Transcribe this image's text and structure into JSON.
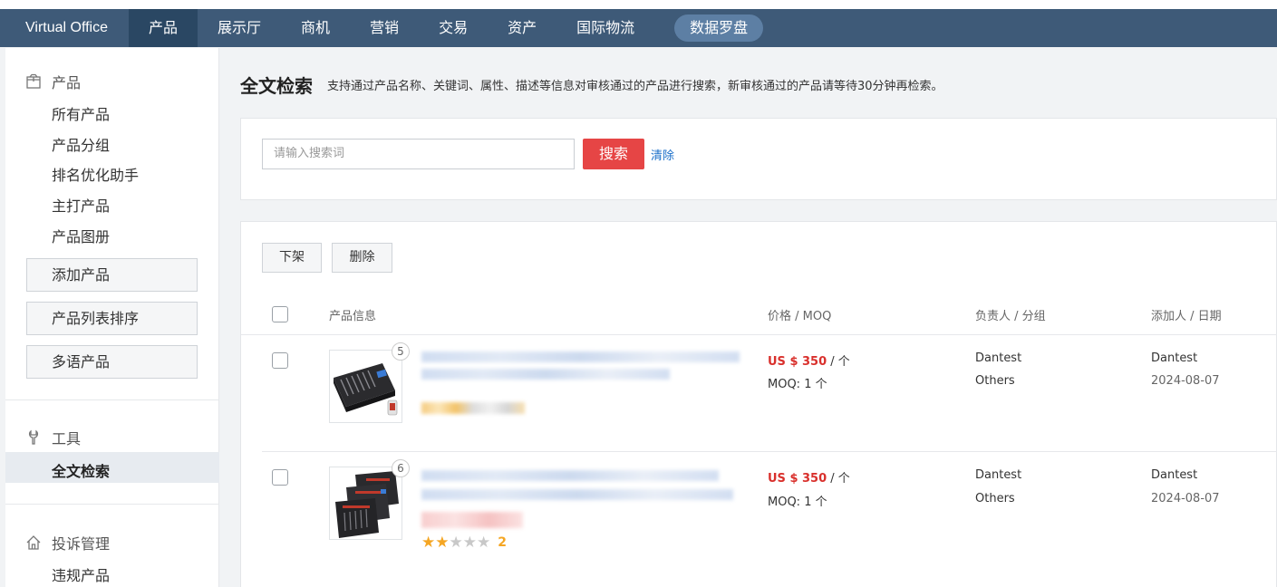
{
  "topbar": {
    "brand": "Virtual Office",
    "nav": [
      "产品",
      "展示厅",
      "商机",
      "营销",
      "交易",
      "资产",
      "国际物流"
    ],
    "pill": "数据罗盘"
  },
  "sidebar": {
    "product_section": "产品",
    "product_items": [
      "所有产品",
      "产品分组",
      "排名优化助手",
      "主打产品",
      "产品图册"
    ],
    "buttons": [
      "添加产品",
      "产品列表排序",
      "多语产品"
    ],
    "tools_section": "工具",
    "tools_items": [
      "全文检索"
    ],
    "complaint_section": "投诉管理",
    "complaint_items": [
      "违规产品"
    ]
  },
  "page": {
    "title": "全文检索",
    "description": "支持通过产品名称、关键词、属性、描述等信息对审核通过的产品进行搜索，新审核通过的产品请等待30分钟再检索。"
  },
  "search": {
    "placeholder": "请输入搜索词",
    "button": "搜索",
    "clear": "清除"
  },
  "actions": {
    "offline": "下架",
    "delete": "删除"
  },
  "table": {
    "headers": [
      "产品信息",
      "价格 / MOQ",
      "负责人 / 分组",
      "添加人 / 日期"
    ],
    "rows": [
      {
        "image_count": "5",
        "price": "US $ 350",
        "price_unit": " / 个",
        "moq": "MOQ: 1 个",
        "owner": "Dantest",
        "group": "Others",
        "added_by": "Dantest",
        "date": "2024-08-07"
      },
      {
        "image_count": "6",
        "price": "US $ 350",
        "price_unit": " / 个",
        "moq": "MOQ: 1 个",
        "owner": "Dantest",
        "group": "Others",
        "added_by": "Dantest",
        "date": "2024-08-07",
        "rating_stars": 2,
        "rating": "2"
      }
    ]
  },
  "colors": {
    "topbar": "#3e5a78",
    "search_button": "#e64545",
    "price": "#d9302c",
    "link": "#1a6fc9",
    "star": "#f5a623"
  }
}
